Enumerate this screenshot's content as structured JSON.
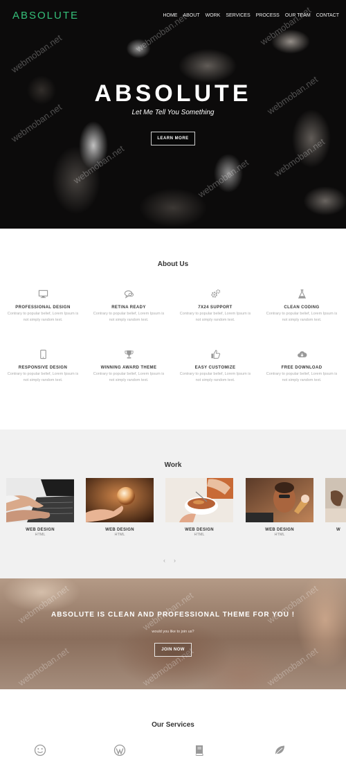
{
  "header": {
    "logo": "ABSOLUTE",
    "nav": [
      "HOME",
      "ABOUT",
      "WORK",
      "SERVICES",
      "PROCESS",
      "OUR TEAM",
      "CONTACT"
    ]
  },
  "hero": {
    "title": "ABSOLUTE",
    "subtitle": "Let Me Tell You Something",
    "button": "LEARN MORE"
  },
  "about": {
    "title": "About Us",
    "features": [
      {
        "icon": "monitor-icon",
        "title": "PROFESSIONAL DESIGN",
        "desc": "Contrary to popular belief, Lorem Ipsum is not simply random text."
      },
      {
        "icon": "chat-bubbles-icon",
        "title": "RETINA READY",
        "desc": "Contrary to popular belief, Lorem Ipsum is not simply random text."
      },
      {
        "icon": "gears-icon",
        "title": "7X24 SUPPORT",
        "desc": "Contrary to popular belief, Lorem Ipsum is not simply random text."
      },
      {
        "icon": "flask-icon",
        "title": "CLEAN CODING",
        "desc": "Contrary to popular belief, Lorem Ipsum is not simply random text."
      },
      {
        "icon": "tablet-icon",
        "title": "RESPONSIVE DESIGN",
        "desc": "Contrary to popular belief, Lorem Ipsum is not simply random text."
      },
      {
        "icon": "trophy-icon",
        "title": "WINNING AWARD THEME",
        "desc": "Contrary to popular belief, Lorem Ipsum is not simply random text."
      },
      {
        "icon": "thumbs-up-icon",
        "title": "EASY CUSTOMIZE",
        "desc": "Contrary to popular belief, Lorem Ipsum is not simply random text."
      },
      {
        "icon": "cloud-download-icon",
        "title": "FREE DOWNLOAD",
        "desc": "Contrary to popular belief, Lorem Ipsum is not simply random text."
      }
    ]
  },
  "work": {
    "title": "Work",
    "items": [
      {
        "title": "WEB DESIGN",
        "sub": "HTML"
      },
      {
        "title": "WEB DESIGN",
        "sub": "HTML"
      },
      {
        "title": "WEB DESIGN",
        "sub": "HTML"
      },
      {
        "title": "WEB DESIGN",
        "sub": "HTML"
      },
      {
        "title": "W",
        "sub": ""
      }
    ],
    "prev": "‹",
    "next": "›"
  },
  "cta": {
    "title": "ABSOLUTE IS CLEAN AND PROFESSIONAL THEME FOR YOU !",
    "subtitle": "would you like to join us?",
    "button": "JOIN NOW"
  },
  "services": {
    "title": "Our Services",
    "icons": [
      "smile-icon",
      "wordpress-icon",
      "book-icon",
      "leaf-icon"
    ]
  },
  "watermark": "webmoban.net",
  "colors": {
    "accent": "#35c07a",
    "work_bg": "#f1f1f1"
  }
}
